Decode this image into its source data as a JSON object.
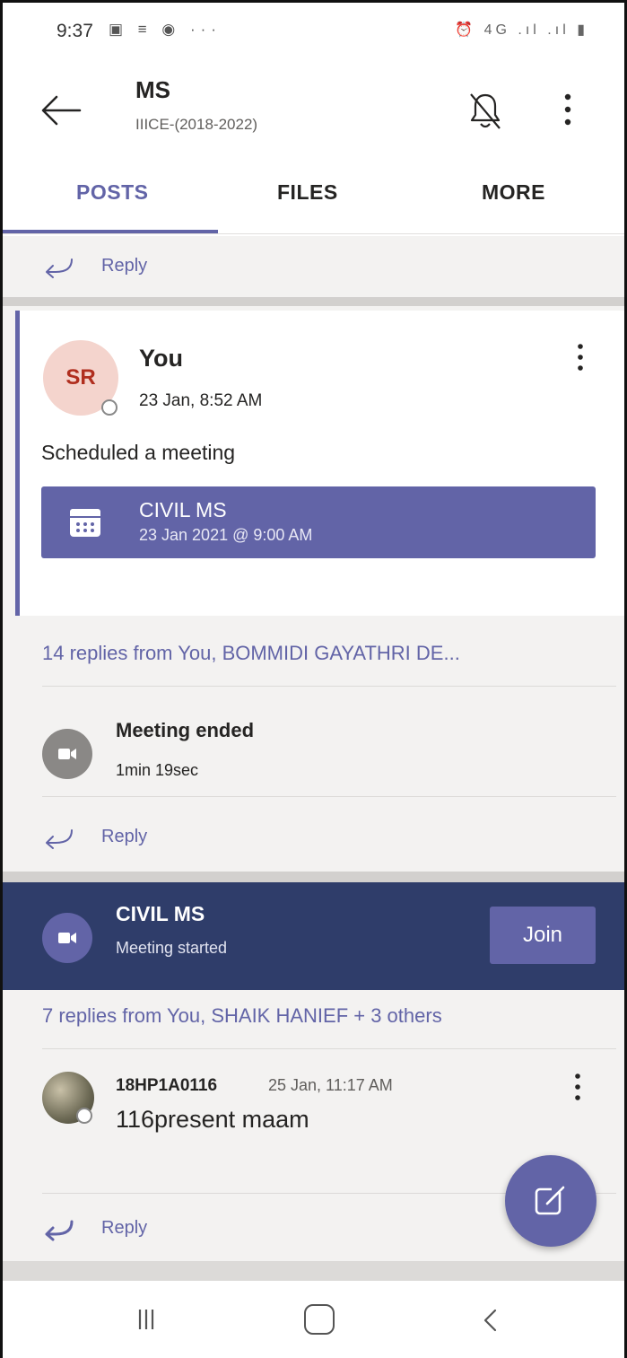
{
  "status_bar": {
    "time": "9:37",
    "left_icons": "▣ ≡ ◉ ···",
    "right_icons": "⏰ 4G .ıl .ıl ▮"
  },
  "header": {
    "title": "MS",
    "subtitle": "IIICE-(2018-2022)"
  },
  "tabs": [
    {
      "label": "POSTS",
      "active": true
    },
    {
      "label": "FILES",
      "active": false
    },
    {
      "label": "MORE",
      "active": false
    }
  ],
  "reply_label": "Reply",
  "post": {
    "avatar_initials": "SR",
    "author": "You",
    "time": "23 Jan, 8:52 AM",
    "text": "Scheduled a meeting",
    "meeting_card": {
      "title": "CIVIL MS",
      "subtitle": "23 Jan 2021 @ 9:00 AM"
    }
  },
  "thread1": {
    "replies_summary": "14 replies from You, BOMMIDI GAYATHRI DE...",
    "event_title": "Meeting ended",
    "event_duration": "1min 19sec"
  },
  "live_meeting": {
    "title": "CIVIL MS",
    "status": "Meeting started",
    "join_label": "Join"
  },
  "thread2": {
    "replies_summary": "7 replies from You, SHAIK HANIEF + 3 others",
    "author": "18HP1A0116",
    "time": "25 Jan, 11:17 AM",
    "text": "116present maam"
  },
  "colors": {
    "brand": "#6264a7",
    "live_banner": "#2f3d6a",
    "background": "#f3f2f1"
  },
  "icons": [
    "back-arrow-icon",
    "bell-off-icon",
    "more-vertical-icon",
    "reply-icon",
    "calendar-icon",
    "video-camera-icon",
    "compose-icon",
    "nav-recents-icon",
    "nav-home-icon",
    "nav-back-icon"
  ]
}
